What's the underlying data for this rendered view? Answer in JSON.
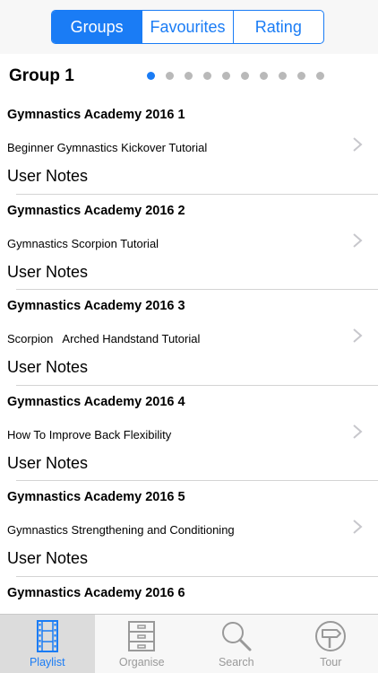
{
  "segments": [
    {
      "label": "Groups",
      "active": true
    },
    {
      "label": "Favourites",
      "active": false
    },
    {
      "label": "Rating",
      "active": false
    }
  ],
  "group": {
    "title": "Group 1"
  },
  "pager": {
    "count": 10,
    "active_index": 0
  },
  "items": [
    {
      "title": "Gymnastics Academy 2016 1",
      "subtitle": "Beginner Gymnastics Kickover Tutorial",
      "notes": "User Notes"
    },
    {
      "title": "Gymnastics Academy 2016 2",
      "subtitle": "Gymnastics Scorpion Tutorial",
      "notes": "User Notes"
    },
    {
      "title": "Gymnastics Academy 2016 3",
      "subtitle": "Scorpion   Arched Handstand Tutorial",
      "notes": "User Notes"
    },
    {
      "title": "Gymnastics Academy 2016 4",
      "subtitle": "How To Improve Back Flexibility",
      "notes": "User Notes"
    },
    {
      "title": "Gymnastics Academy 2016 5",
      "subtitle": "Gymnastics Strengthening and Conditioning",
      "notes": "User Notes"
    },
    {
      "title": "Gymnastics Academy 2016 6",
      "subtitle": "",
      "notes": ""
    }
  ],
  "tabbar": [
    {
      "label": "Playlist",
      "icon": "film-strip-icon",
      "active": true
    },
    {
      "label": "Organise",
      "icon": "cabinet-icon",
      "active": false
    },
    {
      "label": "Search",
      "icon": "magnifier-icon",
      "active": false
    },
    {
      "label": "Tour",
      "icon": "signpost-icon",
      "active": false
    }
  ],
  "colors": {
    "accent": "#1a7cf5",
    "inactive": "#999999",
    "separator": "#d4d4d4"
  }
}
